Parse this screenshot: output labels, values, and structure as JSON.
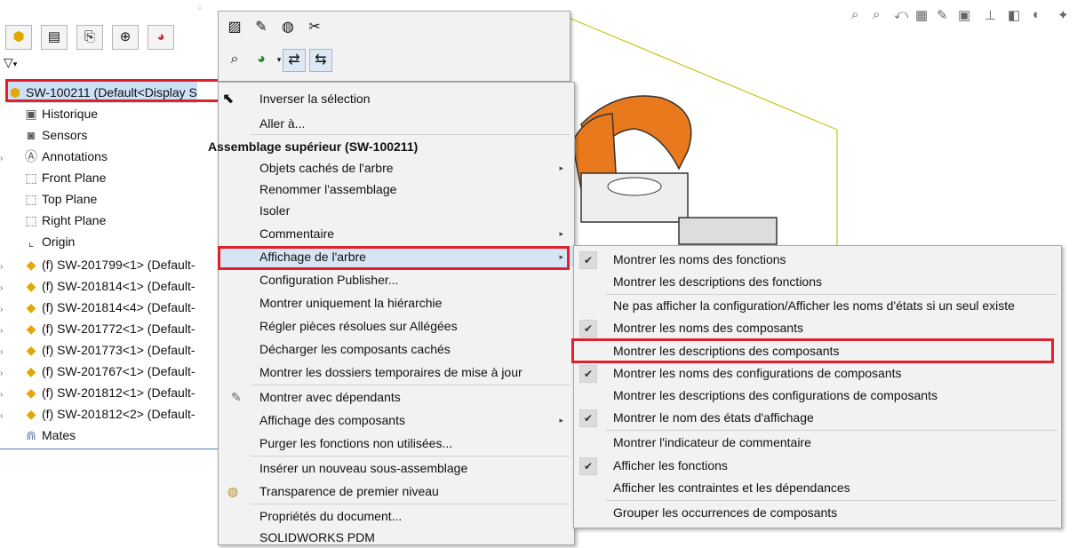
{
  "tree": {
    "filter_icon": "filter-icon",
    "tabs": [
      "feature-manager",
      "property-manager",
      "configuration-manager",
      "dimxpert",
      "display-manager"
    ],
    "root_label": "SW-100211  (Default<Display S",
    "items": [
      {
        "label": "Historique",
        "icon": "history-icon"
      },
      {
        "label": "Sensors",
        "icon": "sensor-icon"
      },
      {
        "label": "Annotations",
        "icon": "annotation-icon"
      },
      {
        "label": "Front Plane",
        "icon": "plane-icon"
      },
      {
        "label": "Top Plane",
        "icon": "plane-icon"
      },
      {
        "label": "Right Plane",
        "icon": "plane-icon"
      },
      {
        "label": "Origin",
        "icon": "origin-icon"
      },
      {
        "label": "(f) SW-201799<1> (Default-",
        "icon": "part-icon"
      },
      {
        "label": "(f) SW-201814<1> (Default-",
        "icon": "part-icon"
      },
      {
        "label": "(f) SW-201814<4> (Default-",
        "icon": "part-icon"
      },
      {
        "label": "(f) SW-201772<1> (Default-",
        "icon": "part-icon"
      },
      {
        "label": "(f) SW-201773<1> (Default-",
        "icon": "part-icon"
      },
      {
        "label": "(f) SW-201767<1> (Default-",
        "icon": "part-icon"
      },
      {
        "label": "(f) SW-201812<1> (Default-",
        "icon": "part-icon"
      },
      {
        "label": "(f) SW-201812<2> (Default-",
        "icon": "part-icon"
      },
      {
        "label": "Mates",
        "icon": "mates-icon"
      }
    ]
  },
  "menu": {
    "items": [
      {
        "label": "Inverser la sélection"
      },
      {
        "label": "Aller à..."
      },
      {
        "label": "Assemblage supérieur (SW-100211)"
      },
      {
        "label": "Objets cachés de l'arbre"
      },
      {
        "label": "Renommer l'assemblage"
      },
      {
        "label": "Isoler"
      },
      {
        "label": "Commentaire"
      },
      {
        "label": "Affichage de l'arbre"
      },
      {
        "label": "Configuration Publisher..."
      },
      {
        "label": "Montrer uniquement la hiérarchie"
      },
      {
        "label": "Régler pièces résolues sur Allégées"
      },
      {
        "label": "Décharger les composants cachés"
      },
      {
        "label": "Montrer les dossiers temporaires de mise à jour"
      },
      {
        "label": "Montrer avec dépendants"
      },
      {
        "label": "Affichage des composants"
      },
      {
        "label": "Purger les fonctions non utilisées..."
      },
      {
        "label": "Insérer un nouveau sous-assemblage"
      },
      {
        "label": "Transparence de premier niveau"
      },
      {
        "label": "Propriétés du document..."
      },
      {
        "label": "SOLIDWORKS PDM"
      }
    ]
  },
  "submenu": {
    "items": [
      {
        "label": "Montrer les noms des fonctions"
      },
      {
        "label": "Montrer les descriptions des fonctions"
      },
      {
        "label": "Ne pas afficher la configuration/Afficher les noms d'états si un seul existe"
      },
      {
        "label": "Montrer les noms des composants"
      },
      {
        "label": "Montrer les descriptions des composants"
      },
      {
        "label": "Montrer les noms des configurations de composants"
      },
      {
        "label": "Montrer les descriptions des configurations de composants"
      },
      {
        "label": "Montrer le nom des états d'affichage"
      },
      {
        "label": "Montrer l'indicateur de commentaire"
      },
      {
        "label": "Afficher les fonctions"
      },
      {
        "label": "Afficher les contraintes et les dépendances"
      },
      {
        "label": "Grouper les occurrences de composants"
      }
    ]
  },
  "colors": {
    "highlight": "#e0202a",
    "menu_bg": "#f2f2f2",
    "handle": "#e87a1d"
  }
}
